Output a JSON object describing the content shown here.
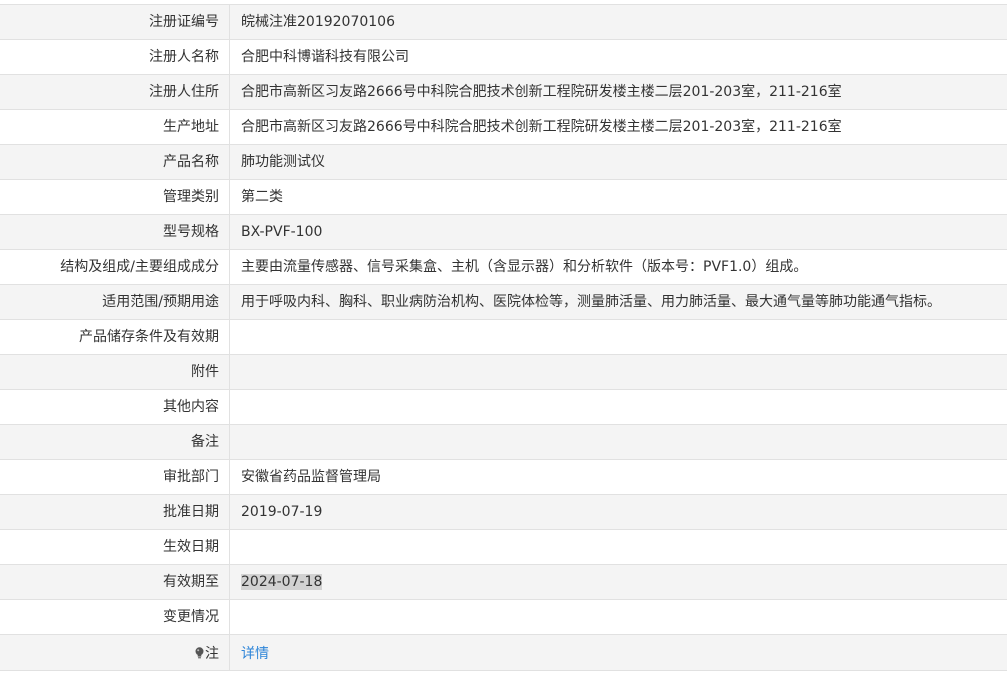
{
  "rows": [
    {
      "label": "注册证编号",
      "value": "皖械注准20192070106"
    },
    {
      "label": "注册人名称",
      "value": "合肥中科博谐科技有限公司"
    },
    {
      "label": "注册人住所",
      "value": "合肥市高新区习友路2666号中科院合肥技术创新工程院研发楼主楼二层201-203室，211-216室"
    },
    {
      "label": "生产地址",
      "value": "合肥市高新区习友路2666号中科院合肥技术创新工程院研发楼主楼二层201-203室，211-216室"
    },
    {
      "label": "产品名称",
      "value": "肺功能测试仪"
    },
    {
      "label": "管理类别",
      "value": "第二类"
    },
    {
      "label": "型号规格",
      "value": "BX-PVF-100"
    },
    {
      "label": "结构及组成/主要组成成分",
      "value": "主要由流量传感器、信号采集盒、主机（含显示器）和分析软件（版本号：PVF1.0）组成。"
    },
    {
      "label": "适用范围/预期用途",
      "value": "用于呼吸内科、胸科、职业病防治机构、医院体检等，测量肺活量、用力肺活量、最大通气量等肺功能通气指标。"
    },
    {
      "label": "产品储存条件及有效期",
      "value": ""
    },
    {
      "label": "附件",
      "value": ""
    },
    {
      "label": "其他内容",
      "value": ""
    },
    {
      "label": "备注",
      "value": ""
    },
    {
      "label": "审批部门",
      "value": "安徽省药品监督管理局"
    },
    {
      "label": "批准日期",
      "value": "2019-07-19"
    },
    {
      "label": "生效日期",
      "value": ""
    },
    {
      "label": "有效期至",
      "value": "2024-07-18"
    },
    {
      "label": "变更情况",
      "value": ""
    }
  ],
  "note": {
    "label": "注",
    "link": "详情",
    "icon": "lightbulb-icon"
  },
  "colors": {
    "link": "#2e85d8",
    "row_alt": "#f4f4f4",
    "border": "#e1e1e1",
    "selection": "#d2d2d2"
  }
}
